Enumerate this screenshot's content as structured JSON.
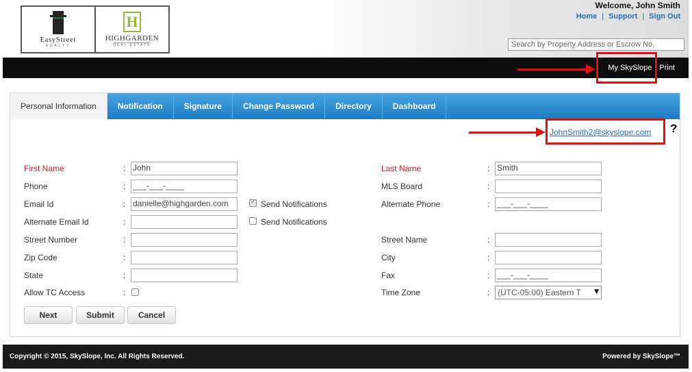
{
  "header": {
    "welcome": "Welcome, John Smith",
    "links": {
      "home": "Home",
      "support": "Support",
      "signout": "Sign Out"
    },
    "search_placeholder": "Search by Property Address or Escrow No.",
    "logo_left": {
      "name": "EasyStreet",
      "sub": "REALTY"
    },
    "logo_right": {
      "name": "HIGHGARDEN",
      "sub": "REAL ESTATE",
      "mark": "H"
    }
  },
  "blackbar": {
    "my_skyslope": "My SkySlope",
    "separator": "|",
    "print": "Print"
  },
  "tabs": [
    {
      "label": "Personal Information",
      "active": true
    },
    {
      "label": "Notification"
    },
    {
      "label": "Signature"
    },
    {
      "label": "Change Password"
    },
    {
      "label": "Directory"
    },
    {
      "label": "Dashboard"
    }
  ],
  "account_email": "JohnSmith2@skyslope.com",
  "help": "?",
  "form": {
    "first_name": {
      "label": "First Name",
      "value": "John"
    },
    "last_name": {
      "label": "Last Name",
      "value": "Smith"
    },
    "phone": {
      "label": "Phone",
      "value": "___-___-____"
    },
    "mls_board": {
      "label": "MLS Board",
      "value": ""
    },
    "email_id": {
      "label": "Email Id",
      "value": "danielle@highgarden.com"
    },
    "email_notify": {
      "label": "Send Notifications",
      "checked": true
    },
    "alt_phone": {
      "label": "Alternate Phone",
      "value": "___-___-____"
    },
    "alt_email": {
      "label": "Alternate Email Id",
      "value": ""
    },
    "alt_email_notify": {
      "label": "Send Notifications",
      "checked": false
    },
    "street_number": {
      "label": "Street Number",
      "value": ""
    },
    "street_name": {
      "label": "Street Name",
      "value": ""
    },
    "zip_code": {
      "label": "Zip Code",
      "value": ""
    },
    "city": {
      "label": "City",
      "value": ""
    },
    "state": {
      "label": "State",
      "value": ""
    },
    "fax": {
      "label": "Fax",
      "value": "___-___-____"
    },
    "tc_access": {
      "label": "Allow TC Access",
      "checked": false
    },
    "time_zone": {
      "label": "Time Zone",
      "value": "(UTC-05:00) Eastern T"
    },
    "colon": ":"
  },
  "buttons": {
    "next": "Next",
    "submit": "Submit",
    "cancel": "Cancel"
  },
  "footer": {
    "copyright": "Copyright © 2015, SkySlope, Inc. All Rights Reserved.",
    "powered": "Powered by SkySlope™"
  },
  "colors": {
    "tab_blue": "#1d7cc4",
    "required_red": "#d0202a",
    "annotation_red": "#e01010",
    "link_blue": "#2a6ebb"
  }
}
